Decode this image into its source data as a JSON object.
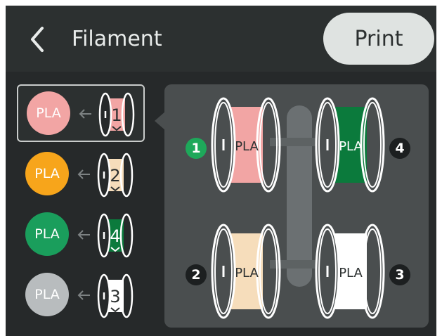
{
  "header": {
    "title": "Filament",
    "print_label": "Print"
  },
  "slots": [
    {
      "material": "PLA",
      "slot_number": "1",
      "color": "#f2a5a4",
      "selected": true
    },
    {
      "material": "PLA",
      "slot_number": "2",
      "color": "#f7a51b",
      "spool_color": "#f6ddbb",
      "selected": false
    },
    {
      "material": "PLA",
      "slot_number": "4",
      "color": "#1a9e5c",
      "spool_color": "#0b7a3c",
      "selected": false
    },
    {
      "material": "PLA",
      "slot_number": "3",
      "color": "#b8bcbe",
      "spool_color": "#ffffff",
      "selected": false
    }
  ],
  "panel_spools": [
    {
      "material": "PLA",
      "slot_number": "1",
      "color": "#f2a5a4",
      "position": "top-left",
      "active": true,
      "active_color": "#1ea85a"
    },
    {
      "material": "PLA",
      "slot_number": "4",
      "color": "#0b7a3c",
      "position": "top-right",
      "active": false
    },
    {
      "material": "PLA",
      "slot_number": "2",
      "color": "#f6ddbb",
      "position": "bottom-left",
      "active": false
    },
    {
      "material": "PLA",
      "slot_number": "3",
      "color": "#ffffff",
      "position": "bottom-right",
      "active": false
    }
  ],
  "icons": {
    "back": "back-chevron-icon",
    "arrow": "arrow-left-icon",
    "spool": "spool-icon"
  }
}
